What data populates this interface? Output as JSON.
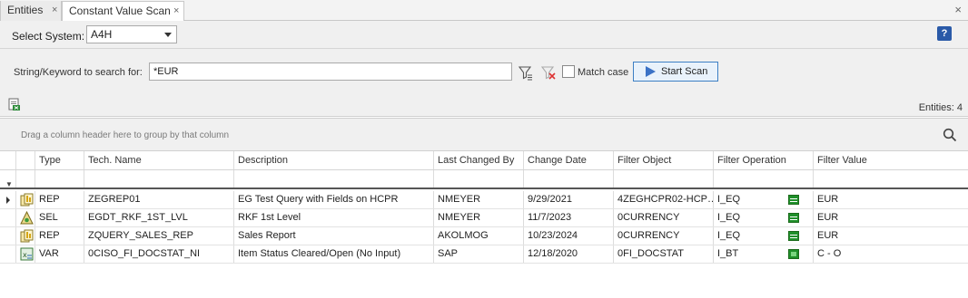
{
  "tabs": [
    {
      "label": "Entities",
      "close": "×"
    },
    {
      "label": "Constant Value Scan",
      "close": "×"
    }
  ],
  "window_close": "×",
  "system": {
    "label": "Select System:",
    "value": "A4H"
  },
  "help_label": "?",
  "search": {
    "label": "String/Keyword to search for:",
    "value": "*EUR",
    "match_case_label": "Match case",
    "match_case_checked": false,
    "scan_button_label": "Start Scan"
  },
  "entities_count": "Entities: 4",
  "group_panel_text": "Drag a column header here to group by that column",
  "grid": {
    "columns": [
      "Type",
      "Tech. Name",
      "Description",
      "Last Changed By",
      "Change Date",
      "Filter Object",
      "Filter Operation",
      "Filter Value"
    ],
    "rows": [
      {
        "icon": "query-icon",
        "type": "REP",
        "tech_name": "ZEGREP01",
        "description": "EG Test Query with Fields on HCPR",
        "changed_by": "NMEYER",
        "change_date": "9/29/2021",
        "filter_object": "4ZEGHCPR02-HCP…",
        "filter_operation": "I_EQ",
        "filter_value": "EUR",
        "op_icon": "equal-icon"
      },
      {
        "icon": "selection-icon",
        "type": "SEL",
        "tech_name": "EGDT_RKF_1ST_LVL",
        "description": "RKF 1st Level",
        "changed_by": "NMEYER",
        "change_date": "11/7/2023",
        "filter_object": "0CURRENCY",
        "filter_operation": "I_EQ",
        "filter_value": "EUR",
        "op_icon": "equal-icon"
      },
      {
        "icon": "query-icon",
        "type": "REP",
        "tech_name": "ZQUERY_SALES_REP",
        "description": "Sales Report",
        "changed_by": "AKOLMOG",
        "change_date": "10/23/2024",
        "filter_object": "0CURRENCY",
        "filter_operation": "I_EQ",
        "filter_value": "EUR",
        "op_icon": "equal-icon"
      },
      {
        "icon": "variable-icon",
        "type": "VAR",
        "tech_name": "0CISO_FI_DOCSTAT_NI",
        "description": "Item Status Cleared/Open (No Input)",
        "changed_by": "SAP",
        "change_date": "12/18/2020",
        "filter_object": "0FI_DOCSTAT",
        "filter_operation": "I_BT",
        "filter_value": "C - O",
        "op_icon": "between-icon"
      }
    ]
  },
  "colors": {
    "accent": "#3c7fc4",
    "operator_green": "#1f8f2a",
    "panel_bg": "#f0f0f0"
  }
}
